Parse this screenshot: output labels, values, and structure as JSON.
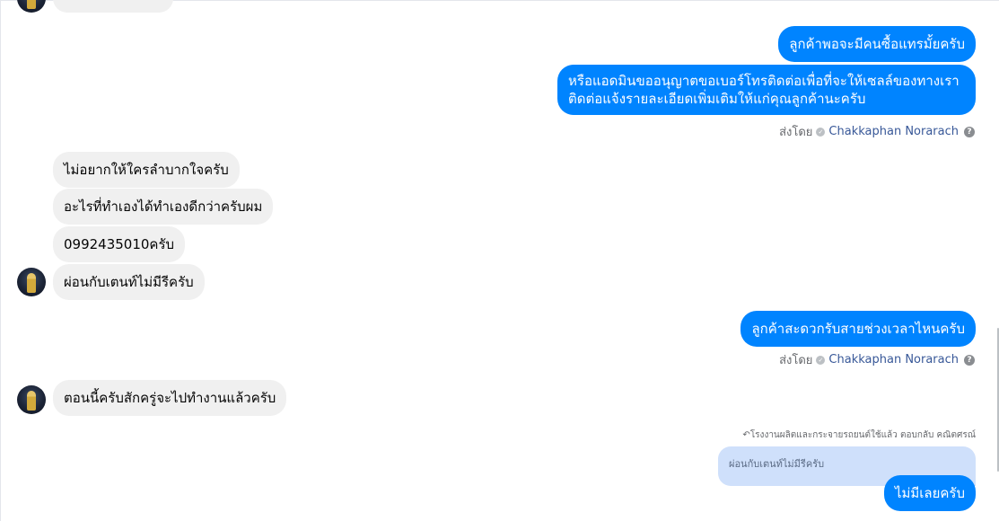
{
  "chat": {
    "outgoing_1": "ลูกค้าพอจะมีคนซื้อแทรมั้ยครับ",
    "outgoing_2": "หรือแอดมินขออนุญาตขอเบอร์โทรติดต่อเพื่อที่จะให้เซลล์ของทางเราติดต่อแจ้งรายละเอียดเพิ่มเติมให้แก่คุณลูกค้านะครับ",
    "sent_by_label": "ส่งโดย",
    "sender_name": "Chakkaphan Norarach",
    "incoming_1": "ไม่อยากให้ใครลำบากใจครับ",
    "incoming_2": "อะไรที่ทำเองได้ทำเองดีกว่าครับผม",
    "incoming_3": "0992435010ครับ",
    "incoming_4": "ผ่อนกับเตนท์ไม่มีรีครับ",
    "outgoing_3": "ลูกค้าสะดวกรับสายช่วงเวลาไหนครับ",
    "incoming_5": "ตอนนี้ครับสักครู่จะไปทำงานแล้วครับ",
    "reply_meta": "โรงงานผลิตและกระจายรถยนต์ใช้แล้ว ตอบกลับ คณิตศรณ์",
    "quoted_text": "ผ่อนกับเตนท์ไม่มีรีครับ",
    "outgoing_4": "ไม่มีเลยครับ"
  },
  "colors": {
    "outgoing_bubble": "#0084ff",
    "incoming_bubble": "#f0f0f0",
    "quoted_bubble": "#cfe0fb",
    "sender_link": "#385898"
  },
  "icons": {
    "verified": "check-circle-icon",
    "help": "question-circle-icon",
    "reply": "reply-arrow-icon"
  }
}
